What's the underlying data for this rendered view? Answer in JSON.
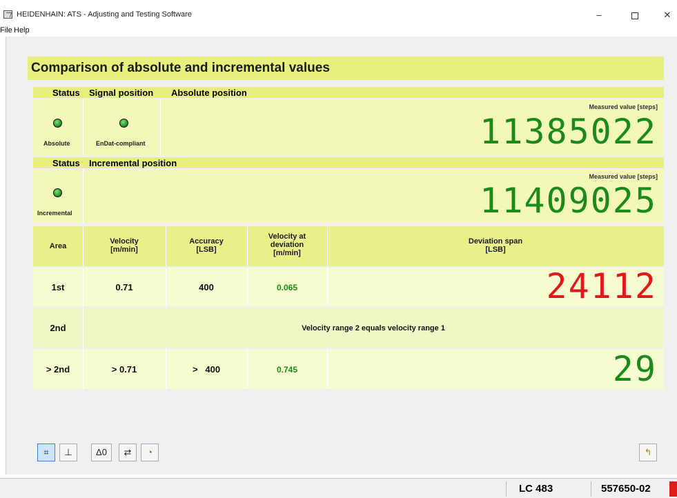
{
  "window": {
    "title": "HEIDENHAIN: ATS - Adjusting and Testing Software",
    "minimize": "–",
    "close": "✕"
  },
  "menu": [
    "File",
    "Help"
  ],
  "panel": {
    "title": "Comparison of absolute and incremental values"
  },
  "absolute": {
    "header_status": "Status",
    "header_signal": "Signal position",
    "header_position": "Absolute position",
    "led_absolute_label": "Absolute",
    "led_endat_label": "EnDat-compliant",
    "measured_label": "Measured value [steps]",
    "measured_value": "11385022"
  },
  "incremental": {
    "header_status": "Status",
    "header_position": "Incremental position",
    "led_label": "Incremental",
    "measured_label": "Measured value [steps]",
    "measured_value": "11409025"
  },
  "table": {
    "headers": {
      "area": "Area",
      "velocity": "Velocity\n[m/min]",
      "accuracy": "Accuracy\n[LSB]",
      "velocity_dev": "Velocity at\ndeviation\n[m/min]",
      "deviation": "Deviation span\n[LSB]"
    },
    "rows": [
      {
        "area": "1st",
        "velocity": "0.71",
        "accuracy": "400",
        "velocity_dev": "0.065",
        "deviation": "24112"
      },
      {
        "area": "2nd",
        "note": "Velocity range 2 equals velocity range 1"
      },
      {
        "area": "> 2nd",
        "velocity": "> 0.71",
        "accuracy": ">   400",
        "velocity_dev": "0.745",
        "deviation": "29"
      }
    ]
  },
  "toolbar": {
    "buttons": [
      {
        "icon": "grid-icon",
        "glyph": "⌗"
      },
      {
        "icon": "axis-icon",
        "glyph": "⊥"
      },
      {
        "icon": "delta-zero-icon",
        "glyph": "Δ0"
      },
      {
        "icon": "swap-icon",
        "glyph": "⇄"
      },
      {
        "icon": "diagnostic-icon",
        "glyph": "◔"
      },
      {
        "icon": "return-icon",
        "glyph": "↰"
      }
    ]
  },
  "status": {
    "model": "LC 483",
    "part": "557650-02"
  },
  "colors": {
    "header_band": "#e7f07c",
    "lcd_green": "#1a8a1a",
    "lcd_red": "#e01919"
  }
}
